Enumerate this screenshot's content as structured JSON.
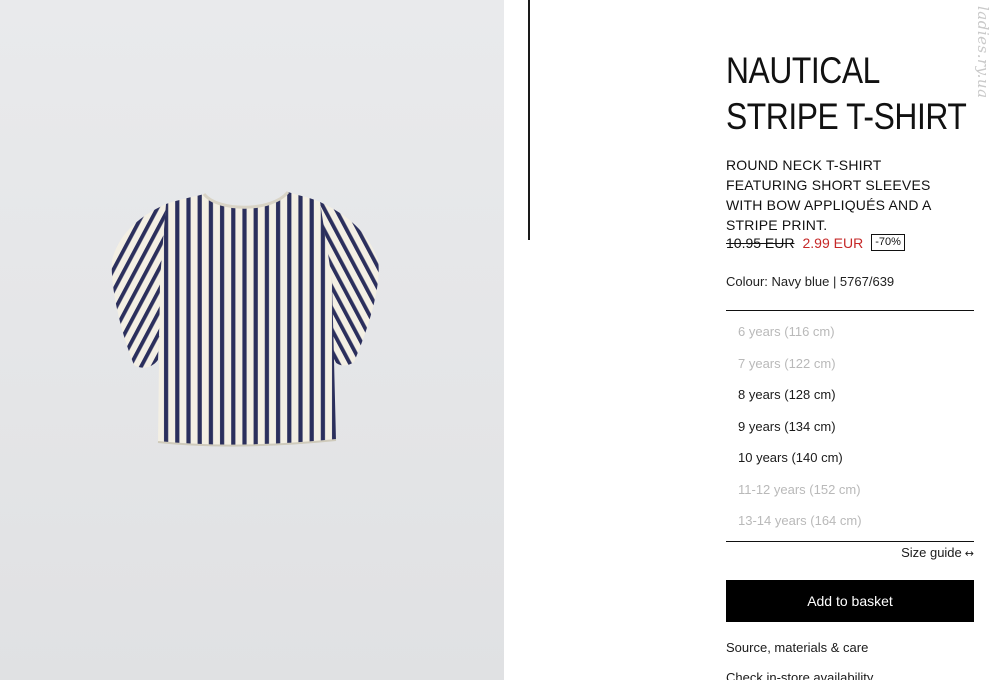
{
  "product": {
    "title_line1": "NAUTICAL",
    "title_line2": "STRIPE T-SHIRT",
    "description": "ROUND NECK T-SHIRT FEATURING SHORT SLEEVES WITH BOW APPLIQUÉS AND A STRIPE PRINT.",
    "original_price": "10.95 EUR",
    "sale_price": "2.99 EUR",
    "discount": "-70%",
    "colour_line": "Colour: Navy blue | 5767/639"
  },
  "sizes": [
    {
      "label": "6 years (116 cm)",
      "available": false
    },
    {
      "label": "7 years (122 cm)",
      "available": false
    },
    {
      "label": "8 years (128 cm)",
      "available": true
    },
    {
      "label": "9 years (134 cm)",
      "available": true
    },
    {
      "label": "10 years (140 cm)",
      "available": true
    },
    {
      "label": "11-12 years (152 cm)",
      "available": false
    },
    {
      "label": "13-14 years (164 cm)",
      "available": false
    }
  ],
  "actions": {
    "size_guide": "Size guide",
    "size_guide_icon": "↔",
    "add_to_basket": "Add to basket",
    "materials_link": "Source, materials & care",
    "store_link": "Check in-store availability"
  },
  "watermark": "ladies.ry.ua",
  "colors": {
    "sale_red": "#c62828",
    "stripe_navy": "#2b2f5c",
    "shirt_base": "#f3efe4",
    "button_black": "#000000"
  },
  "icons": {
    "size_guide_icon": "arrows-width-icon"
  }
}
